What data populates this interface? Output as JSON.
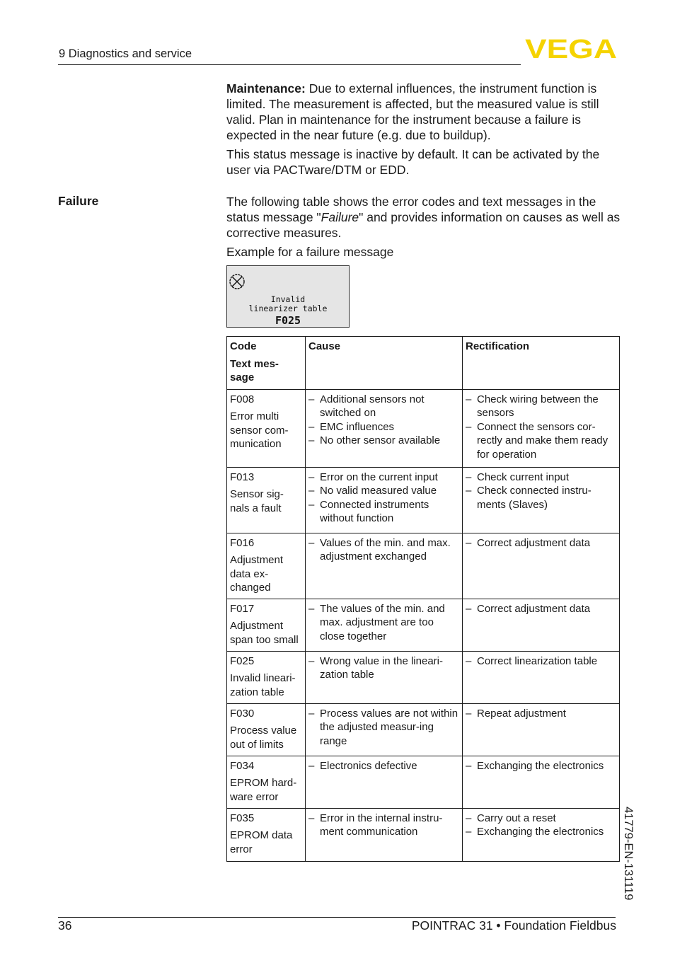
{
  "header": {
    "section_title": "9 Diagnostics and service",
    "logo_text": "VEGA",
    "logo_color": "#F5D300"
  },
  "maintenance": {
    "label": "Maintenance:",
    "text": " Due to external influences, the instrument function is limited. The measurement is affected, but the measured value is still valid. Plan in maintenance for the instrument  because a failure is expected in the near future (e.g. due to buildup).",
    "note": "This status message is inactive by default. It can be activated by the user via PACTware/DTM or EDD."
  },
  "failure": {
    "side_label": "Failure",
    "intro_before": "The following table shows the error codes and text messages in the status message \"",
    "intro_italic": "Failure",
    "intro_after": "\" and provides information on causes as well as corrective measures.",
    "example_caption": "Example for a failure message",
    "display": {
      "icon": "failure-cross-circle-icon",
      "line1": "Invalid",
      "line2": "linearizer table",
      "code": "F025"
    }
  },
  "table": {
    "headers": {
      "code": "Code",
      "text_message": "Text mes-\nsage",
      "cause": "Cause",
      "rectification": "Rectification"
    },
    "rows": [
      {
        "code": "F008",
        "message": "Error multi sensor com-munication",
        "cause": [
          "Additional sensors not switched on",
          "EMC influences",
          "No other sensor available"
        ],
        "rectification": [
          "Check wiring between the sensors",
          "Connect the sensors cor-rectly and make them ready for operation"
        ]
      },
      {
        "code": "F013",
        "message": "Sensor sig-nals a fault",
        "cause": [
          "Error on the current input",
          "No valid measured value",
          "Connected instruments without function"
        ],
        "rectification": [
          "Check current input",
          "Check connected instru-ments (Slaves)"
        ]
      },
      {
        "code": "F016",
        "message": "Adjustment data ex-changed",
        "cause": [
          "Values of the min. and max. adjustment exchanged"
        ],
        "rectification": [
          "Correct adjustment data"
        ]
      },
      {
        "code": "F017",
        "message": "Adjustment span too small",
        "cause": [
          "The values of the min. and max. adjustment are too close together"
        ],
        "rectification": [
          "Correct adjustment data"
        ]
      },
      {
        "code": "F025",
        "message": "Invalid lineari-zation table",
        "cause": [
          "Wrong value in the lineari-zation table"
        ],
        "rectification": [
          "Correct linearization table"
        ]
      },
      {
        "code": "F030",
        "message": "Process value out of limits",
        "cause": [
          "Process values are not within the adjusted measur-ing range"
        ],
        "rectification": [
          "Repeat adjustment"
        ]
      },
      {
        "code": "F034",
        "message": "EPROM hard-ware error",
        "cause": [
          "Electronics defective"
        ],
        "rectification": [
          "Exchanging the electronics"
        ]
      },
      {
        "code": "F035",
        "message": "EPROM data error",
        "cause": [
          "Error in the internal instru-ment communication"
        ],
        "rectification": [
          "Carry out a reset",
          "Exchanging the electronics"
        ]
      }
    ]
  },
  "footer": {
    "page_number": "36",
    "doc_title": "POINTRAC 31 • Foundation Fieldbus",
    "doc_id": "41779-EN-131119"
  }
}
